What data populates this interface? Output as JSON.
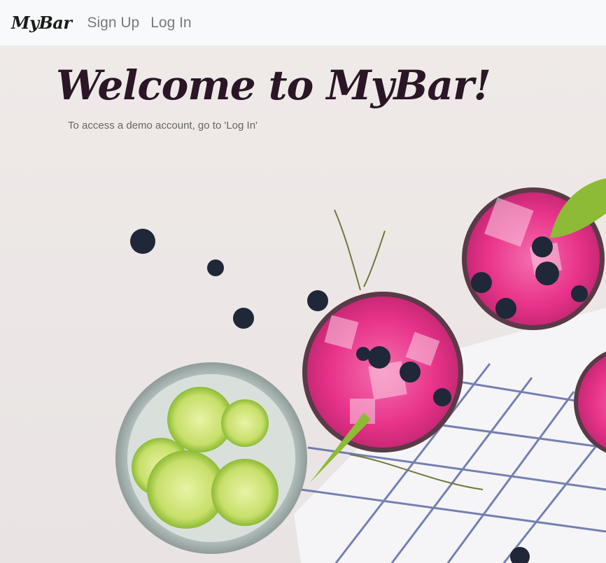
{
  "navbar": {
    "brand": "MyBar",
    "links": [
      "Sign Up",
      "Log In"
    ]
  },
  "hero": {
    "title": "Welcome to MyBar!",
    "subtitle": "To access a demo account, go to 'Log In'"
  },
  "colors": {
    "navbar_bg": "#f8f9fa",
    "title": "#2a1626",
    "drink": "#e8338a",
    "lime": "#b8d84a",
    "blueberry": "#1f2738"
  }
}
